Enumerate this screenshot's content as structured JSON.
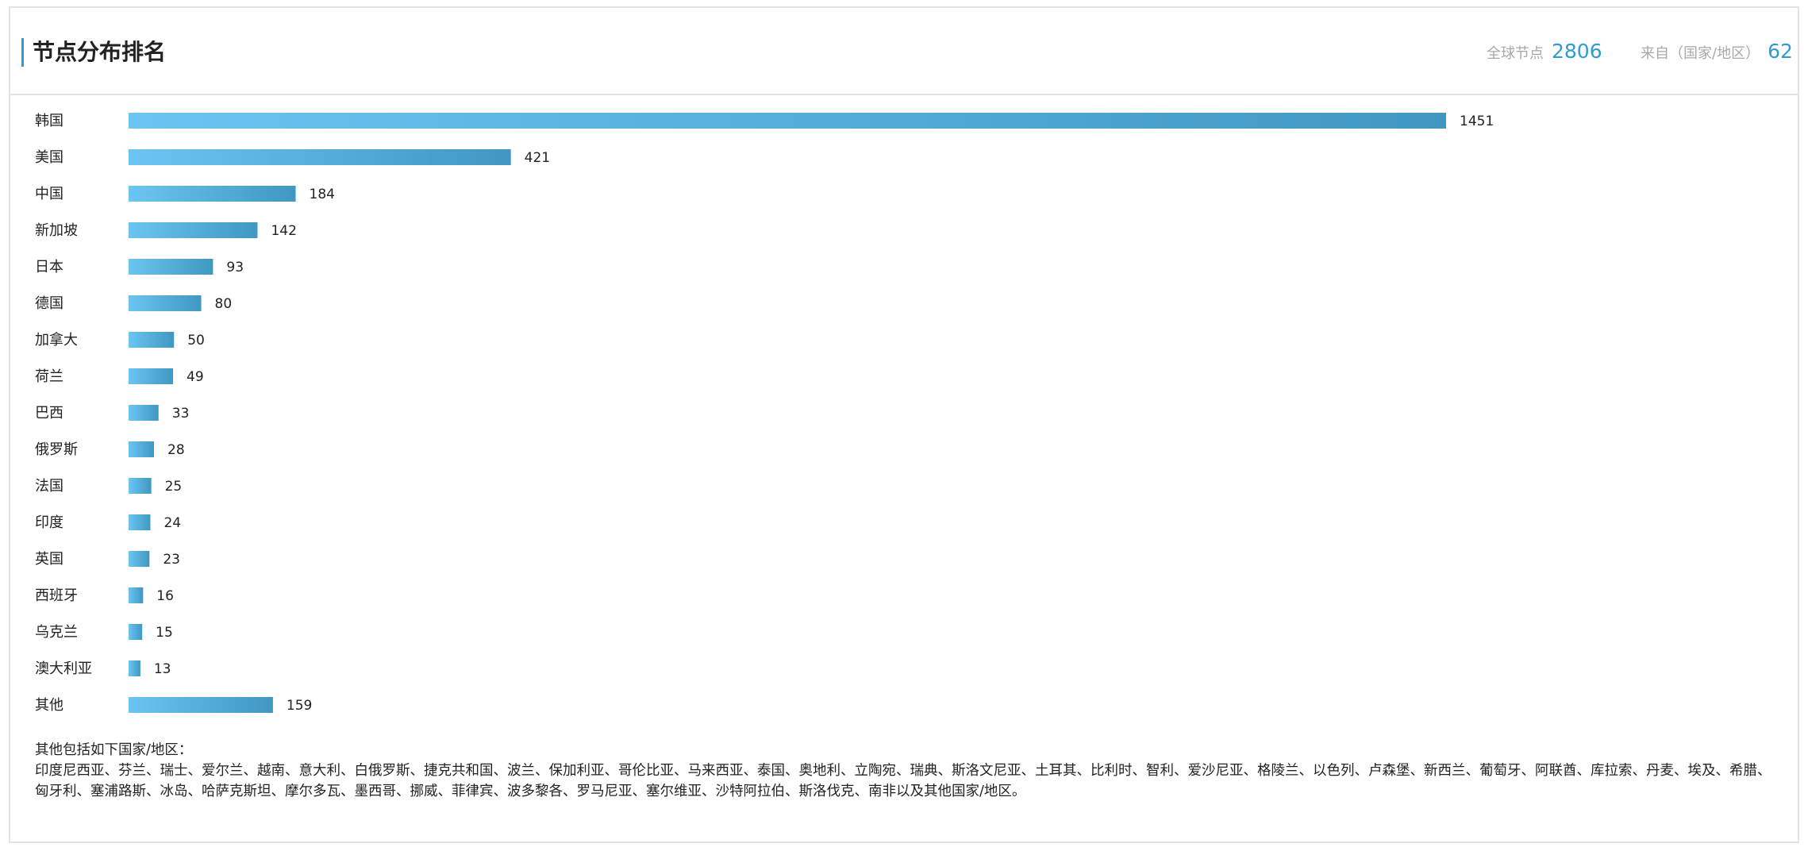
{
  "header": {
    "title": "节点分布排名",
    "stats": {
      "nodes_label": "全球节点",
      "nodes_value": "2806",
      "countries_label": "来自（国家/地区）",
      "countries_value": "62"
    }
  },
  "colors": {
    "accent": "#2f9bd0",
    "bar_gradient_start": "#6cc4f2",
    "bar_gradient_end": "#3f97c2",
    "border": "#e3e3e3"
  },
  "chart_data": {
    "type": "bar",
    "orientation": "horizontal",
    "categories": [
      "韩国",
      "美国",
      "中国",
      "新加坡",
      "日本",
      "德国",
      "加拿大",
      "荷兰",
      "巴西",
      "俄罗斯",
      "法国",
      "印度",
      "英国",
      "西班牙",
      "乌克兰",
      "澳大利亚",
      "其他"
    ],
    "values": [
      1451,
      421,
      184,
      142,
      93,
      80,
      50,
      49,
      33,
      28,
      25,
      24,
      23,
      16,
      15,
      13,
      159
    ],
    "title": "",
    "xlabel": "",
    "ylabel": "",
    "grid": false,
    "legend": "none",
    "data_labels": true
  },
  "note": {
    "title": "其他包括如下国家/地区：",
    "text": "印度尼西亚、芬兰、瑞士、爱尔兰、越南、意大利、白俄罗斯、捷克共和国、波兰、保加利亚、哥伦比亚、马来西亚、泰国、奥地利、立陶宛、瑞典、斯洛文尼亚、土耳其、比利时、智利、爱沙尼亚、格陵兰、以色列、卢森堡、新西兰、葡萄牙、阿联酋、库拉索、丹麦、埃及、希腊、匈牙利、塞浦路斯、冰岛、哈萨克斯坦、摩尔多瓦、墨西哥、挪威、菲律宾、波多黎各、罗马尼亚、塞尔维亚、沙特阿拉伯、斯洛伐克、南非以及其他国家/地区。"
  }
}
